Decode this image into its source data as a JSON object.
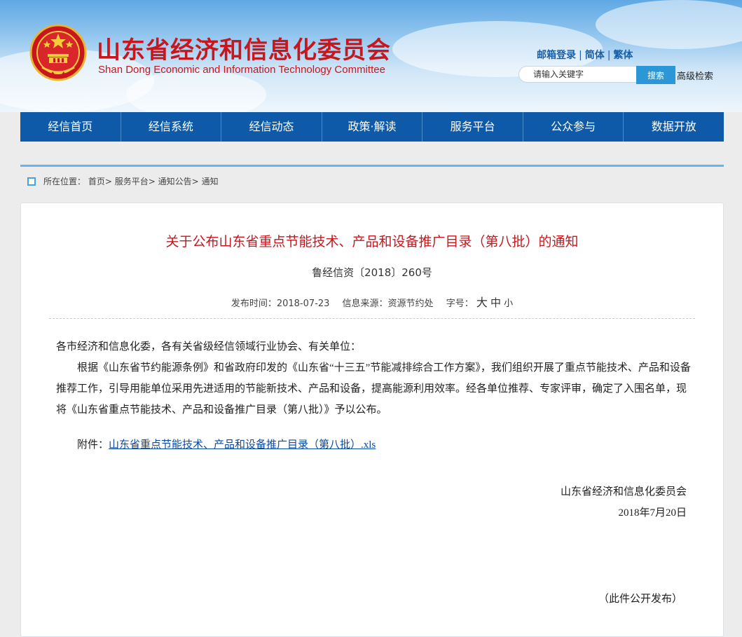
{
  "header": {
    "title": "山东省经济和信息化委员会",
    "subtitle": "Shan Dong Economic and Information Technology Committee",
    "links": [
      "邮箱登录",
      "简体",
      "繁体"
    ],
    "search": {
      "placeholder": "请输入关键字",
      "button": "搜索",
      "advanced": "高级检索"
    }
  },
  "nav": [
    "经信首页",
    "经信系统",
    "经信动态",
    "政策·解读",
    "服务平台",
    "公众参与",
    "数据开放"
  ],
  "breadcrumb": {
    "prefix": "所在位置：",
    "items": [
      "首页",
      "服务平台",
      "通知公告",
      "通知"
    ],
    "separator": ">"
  },
  "article": {
    "title": "关于公布山东省重点节能技术、产品和设备推广目录（第八批）的通知",
    "doc_number": "鲁经信资〔2018〕260号",
    "meta": {
      "publish_label": "发布时间：",
      "publish_date": "2018-07-23",
      "source_label": "信息来源：",
      "source": "资源节约处",
      "font_label": "字号：",
      "font_large": "大",
      "font_medium": "中",
      "font_small": "小"
    },
    "salutation": "各市经济和信息化委，各有关省级经信领域行业协会、有关单位：",
    "paragraph": "根据《山东省节约能源条例》和省政府印发的《山东省“十三五”节能减排综合工作方案》，我们组织开展了重点节能技术、产品和设备推荐工作，引导用能单位采用先进适用的节能新技术、产品和设备，提高能源利用效率。经各单位推荐、专家评审，确定了入围名单，现将《山东省重点节能技术、产品和设备推广目录（第八批）》予以公布。",
    "attachment_label": "附件：",
    "attachment_link": "山东省重点节能技术、产品和设备推广目录（第八批）.xls",
    "signature": "山东省经济和信息化委员会",
    "date": "2018年7月20日",
    "publish_note": "（此件公开发布）"
  },
  "colors": {
    "brand_red": "#c8161d",
    "nav_blue": "#0e5aa8",
    "link_blue": "#0b4aa2",
    "button_blue": "#2b97d6"
  }
}
